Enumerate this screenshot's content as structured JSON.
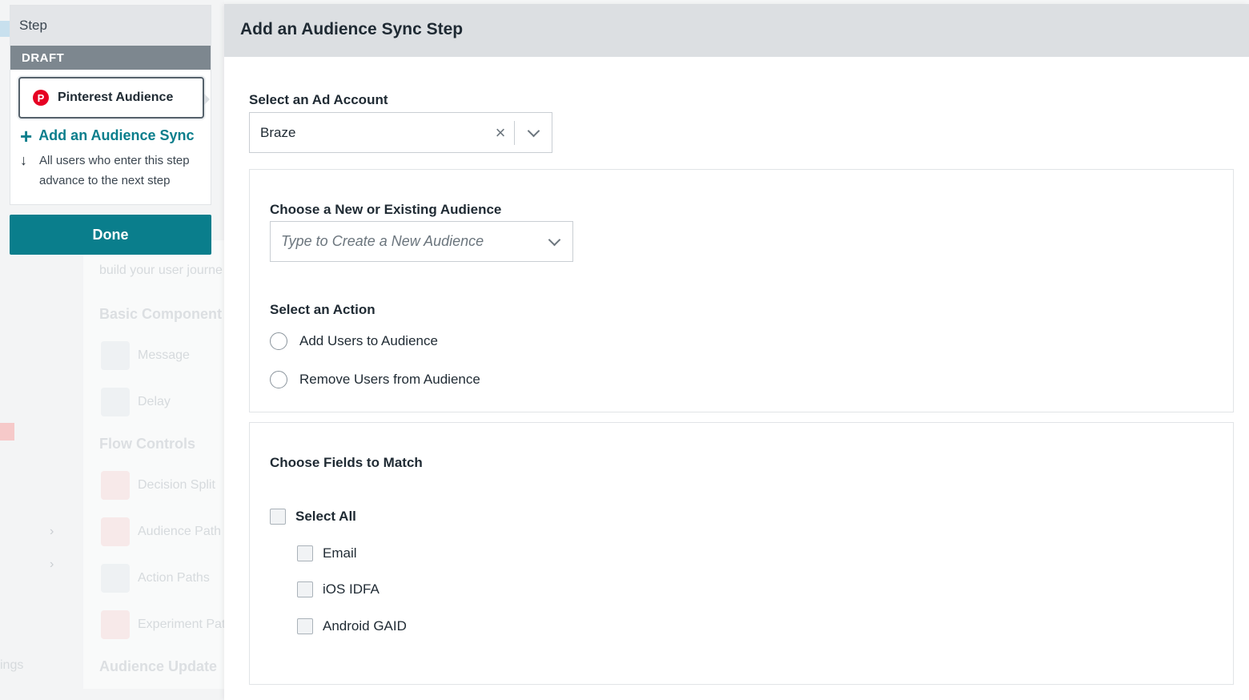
{
  "step_card": {
    "header": "Step",
    "status": "DRAFT",
    "channel_chip": {
      "label": "Pinterest Audience",
      "icon": "pinterest-icon"
    },
    "add_sync_label": "Add an Audience Sync",
    "advance_text": "All users who enter this step advance to the next step"
  },
  "done_label": "Done",
  "background": {
    "panel_text": "build your user journe",
    "basic_components": "Basic Component",
    "message": "Message",
    "delay": "Delay",
    "flow_controls": "Flow Controls",
    "decision_split": "Decision Split",
    "audience_paths": "Audience Path",
    "action_paths": "Action Paths",
    "experiment_paths": "Experiment Pat",
    "audience_update": "Audience Update",
    "settings_partial": "ings"
  },
  "modal": {
    "title": "Add an Audience Sync Step",
    "ad_account": {
      "label": "Select an Ad Account",
      "value": "Braze"
    },
    "audience": {
      "label": "Choose a New or Existing Audience",
      "placeholder": "Type to Create a New Audience"
    },
    "action": {
      "label": "Select an Action",
      "options": [
        "Add Users to Audience",
        "Remove Users from Audience"
      ]
    },
    "fields": {
      "label": "Choose Fields to Match",
      "select_all": "Select All",
      "options": [
        "Email",
        "iOS IDFA",
        "Android GAID"
      ]
    }
  }
}
